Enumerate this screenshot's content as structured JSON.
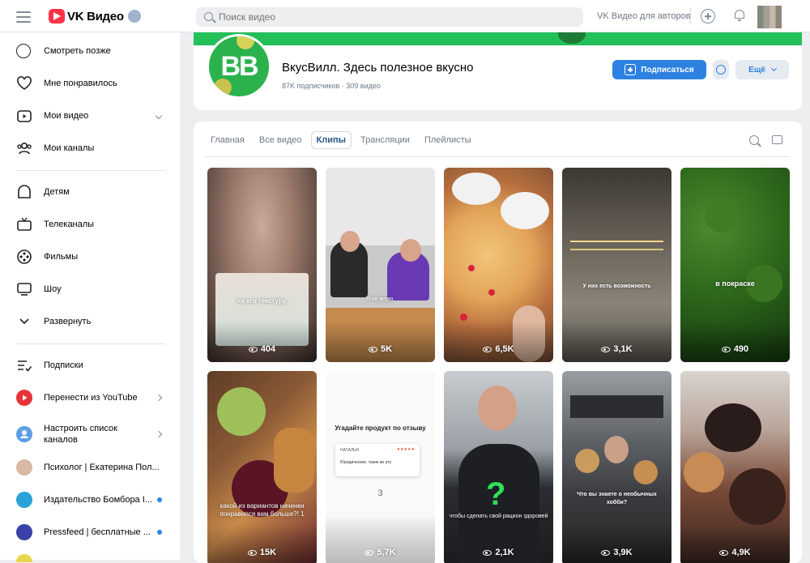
{
  "header": {
    "logo_text": "VK Видео",
    "search_placeholder": "Поиск видео",
    "for_authors": "VK Видео для авторов"
  },
  "sidebar": {
    "items": [
      {
        "label": "Смотреть позже",
        "icon": "clock-icon"
      },
      {
        "label": "Мне понравилось",
        "icon": "heart-icon"
      },
      {
        "label": "Мои видео",
        "icon": "video-icon"
      },
      {
        "label": "Мои каналы",
        "icon": "people-icon"
      },
      {
        "label": "Детям",
        "icon": "kids-icon"
      },
      {
        "label": "Телеканалы",
        "icon": "tv-icon"
      },
      {
        "label": "Фильмы",
        "icon": "film-reel-icon"
      },
      {
        "label": "Шоу",
        "icon": "monitor-icon"
      },
      {
        "label": "Развернуть",
        "icon": "chevron-down-icon"
      },
      {
        "label": "Подписки",
        "icon": "list-check-icon"
      },
      {
        "label": "Перенести из YouTube",
        "icon": "youtube-icon"
      },
      {
        "label": "Настроить список каналов",
        "icon": "person-circle-icon"
      },
      {
        "label": "Психолог | Екатерина Пол...",
        "icon": "channel-avatar"
      },
      {
        "label": "Издательство Бомбора I...",
        "icon": "channel-avatar"
      },
      {
        "label": "Pressfeed | бесплатные ...",
        "icon": "channel-avatar"
      }
    ]
  },
  "channel": {
    "avatar_text": "BB",
    "title": "ВкусВилл. Здесь полезное вкусно",
    "meta": "87K подписчиков · 309 видео",
    "subscribe_label": "Подписаться",
    "more_label": "Ещё"
  },
  "tabs": [
    "Главная",
    "Все видео",
    "Клипы",
    "Трансляции",
    "Плейлисты"
  ],
  "active_tab": "Клипы",
  "clips": [
    {
      "caption": "на его текстуру.",
      "views": "404"
    },
    {
      "caption": "Я не верю.",
      "views": "5K"
    },
    {
      "caption": "",
      "views": "6,5K"
    },
    {
      "caption": "У них есть возможность",
      "views": "3,1K"
    },
    {
      "caption": "в покраске",
      "views": "490"
    },
    {
      "caption": "какой из вариантов начинки понравился вам больше?! 1",
      "views": "15K"
    },
    {
      "caption": "Угадайте продукт по отзыву",
      "views": "5,7K",
      "card_name": "НАТАЛЬЯ",
      "card_text": "Юридические, такие во рту",
      "card_number": "3"
    },
    {
      "caption": "чтобы сделать свой рацион здоровей",
      "views": "2,1K"
    },
    {
      "caption": "Что вы знаете о необычных хобби?",
      "views": "3,9K"
    },
    {
      "caption": "",
      "views": "4,9K"
    }
  ]
}
